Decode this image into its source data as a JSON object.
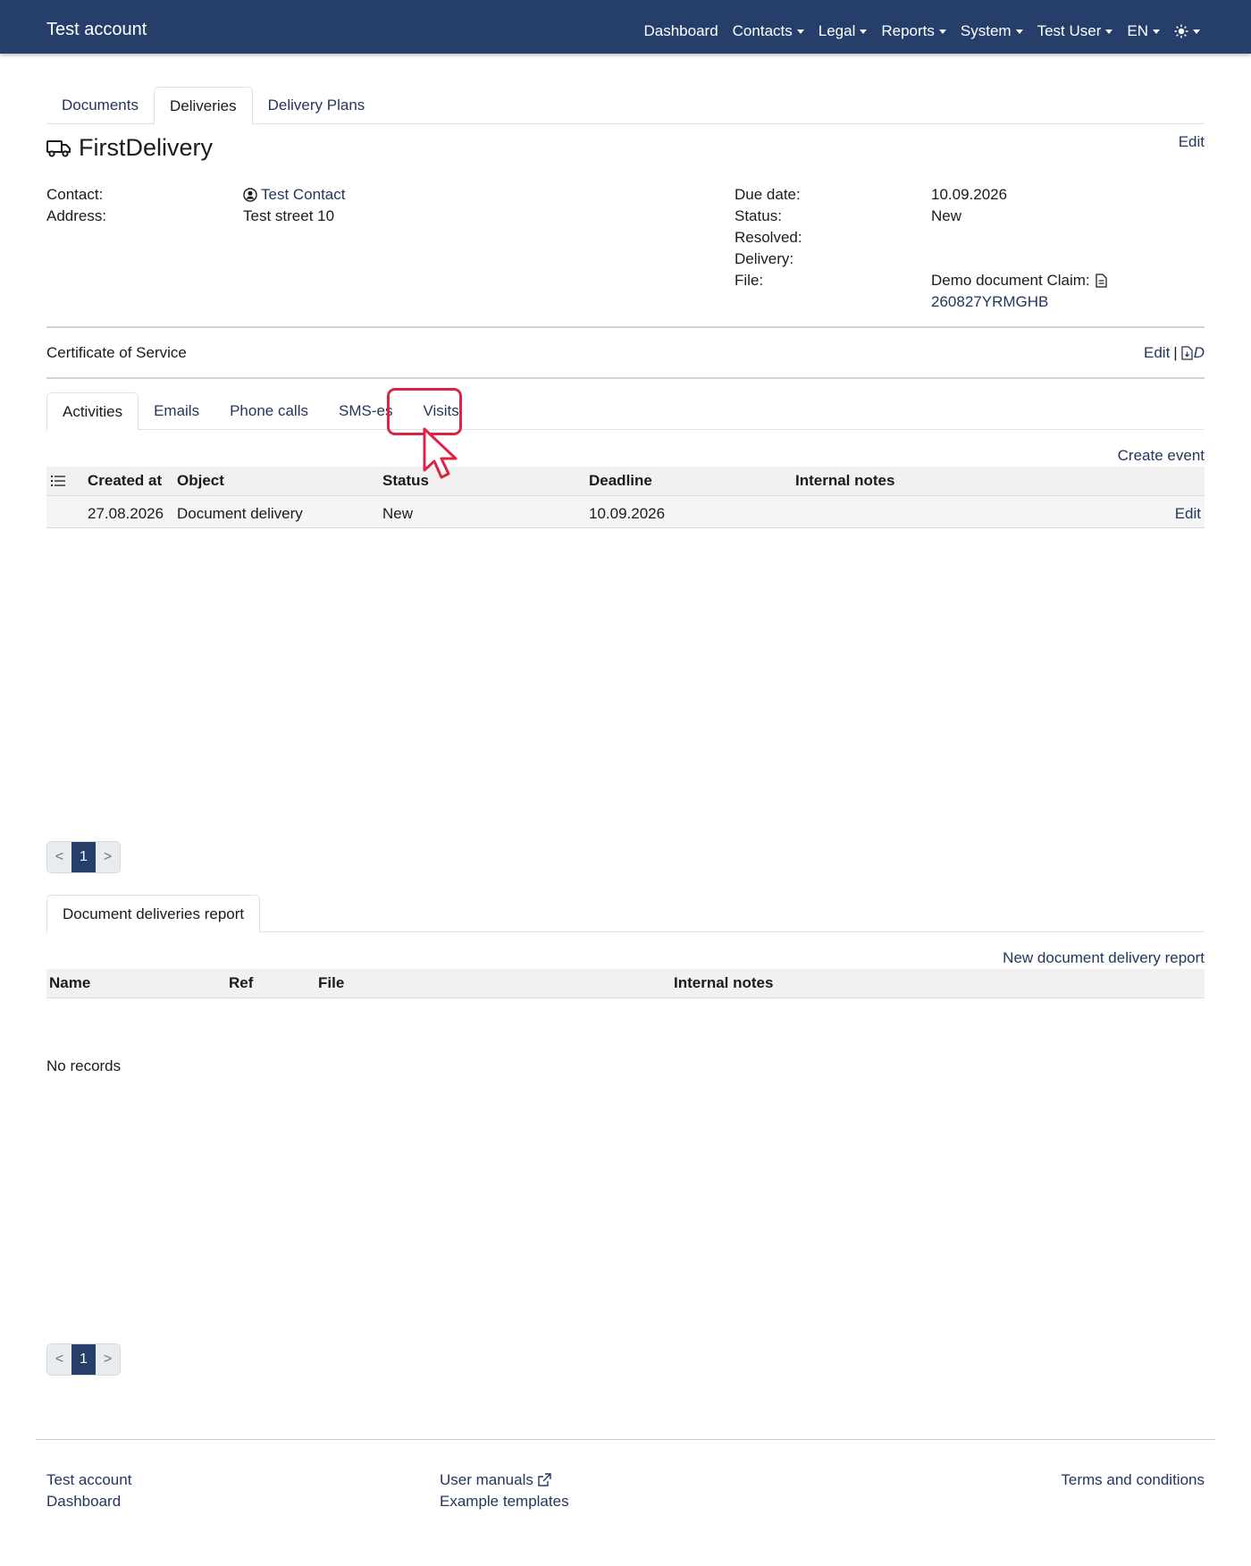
{
  "navbar": {
    "brand": "Test account",
    "items": [
      {
        "label": "Dashboard",
        "dropdown": false
      },
      {
        "label": "Contacts",
        "dropdown": true
      },
      {
        "label": "Legal",
        "dropdown": true
      },
      {
        "label": "Reports",
        "dropdown": true
      },
      {
        "label": "System",
        "dropdown": true
      },
      {
        "label": "Test User",
        "dropdown": true
      },
      {
        "label": "EN",
        "dropdown": true
      }
    ],
    "theme_icon": "sun-icon"
  },
  "top_tabs": [
    {
      "label": "Documents",
      "active": false
    },
    {
      "label": "Deliveries",
      "active": true
    },
    {
      "label": "Delivery Plans",
      "active": false
    }
  ],
  "delivery": {
    "icon": "truck-icon",
    "title": "FirstDelivery",
    "edit_label": "Edit",
    "contact_label": "Contact:",
    "contact_value": "Test Contact",
    "address_label": "Address:",
    "address_value": "Test street 10",
    "due_date_label": "Due date:",
    "due_date_value": "10.09.2026",
    "status_label": "Status:",
    "status_value": "New",
    "resolved_label": "Resolved:",
    "delivery_label": "Delivery:",
    "file_label": "File:",
    "file_value": "Demo document Claim:",
    "file_ref": "260827YRMGHB"
  },
  "certificate": {
    "label": "Certificate of Service",
    "edit_label": "Edit",
    "separator": "|",
    "pdf_label": "D"
  },
  "activity_tabs": [
    {
      "label": "Activities",
      "active": true
    },
    {
      "label": "Emails",
      "active": false
    },
    {
      "label": "Phone calls",
      "active": false
    },
    {
      "label": "SMS-es",
      "active": false
    },
    {
      "label": "Visits",
      "active": false
    }
  ],
  "activities": {
    "create_label": "Create event",
    "columns": [
      "Created at",
      "Object",
      "Status",
      "Deadline",
      "Internal notes"
    ],
    "rows": [
      {
        "created_at": "27.08.2026",
        "object": "Document delivery",
        "status": "New",
        "deadline": "10.09.2026",
        "notes": "",
        "action": "Edit"
      }
    ]
  },
  "pager": {
    "prev": "<",
    "page": "1",
    "next": ">"
  },
  "reports": {
    "tab_label": "Document deliveries report",
    "new_label": "New document delivery report",
    "columns": [
      "Name",
      "Ref",
      "File",
      "Internal notes"
    ],
    "empty": "No records"
  },
  "footer": {
    "col1": [
      "Test account",
      "Dashboard"
    ],
    "col2": [
      "User manuals",
      "Example templates"
    ],
    "col3": [
      "Terms and conditions"
    ]
  },
  "colors": {
    "navbar": "#263f6a",
    "link": "#24365e",
    "highlight": "#dc2545"
  }
}
